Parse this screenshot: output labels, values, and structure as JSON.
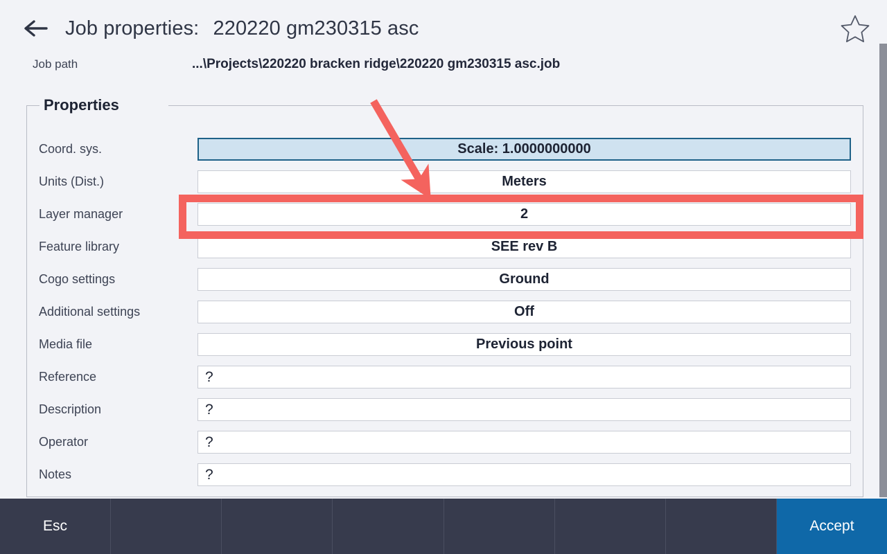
{
  "header": {
    "back_icon": "arrow-left-icon",
    "title_prefix": "Job properties:",
    "job_name": "220220 gm230315 asc",
    "favorite_icon": "star-outline-icon"
  },
  "job_path": {
    "label": "Job path",
    "value": "...\\Projects\\220220 bracken ridge\\220220 gm230315 asc.job"
  },
  "properties": {
    "legend": "Properties",
    "rows": [
      {
        "label": "Coord. sys.",
        "value": "Scale:  1.0000000000",
        "selected": true,
        "align": "center"
      },
      {
        "label": "Units (Dist.)",
        "value": "Meters",
        "selected": false,
        "align": "center"
      },
      {
        "label": "Layer manager",
        "value": "2",
        "selected": false,
        "align": "center"
      },
      {
        "label": "Feature library",
        "value": "SEE rev B",
        "selected": false,
        "align": "center"
      },
      {
        "label": "Cogo settings",
        "value": "Ground",
        "selected": false,
        "align": "center"
      },
      {
        "label": "Additional settings",
        "value": "Off",
        "selected": false,
        "align": "center"
      },
      {
        "label": "Media file",
        "value": "Previous point",
        "selected": false,
        "align": "center"
      },
      {
        "label": "Reference",
        "value": "?",
        "selected": false,
        "align": "left"
      },
      {
        "label": "Description",
        "value": "?",
        "selected": false,
        "align": "left"
      },
      {
        "label": "Operator",
        "value": "?",
        "selected": false,
        "align": "left"
      },
      {
        "label": "Notes",
        "value": "?",
        "selected": false,
        "align": "left"
      }
    ]
  },
  "toolbar": {
    "cells": [
      {
        "label": "Esc",
        "accept": false
      },
      {
        "label": "",
        "accept": false
      },
      {
        "label": "",
        "accept": false
      },
      {
        "label": "",
        "accept": false
      },
      {
        "label": "",
        "accept": false
      },
      {
        "label": "",
        "accept": false
      },
      {
        "label": "",
        "accept": false
      },
      {
        "label": "Accept",
        "accept": true
      }
    ]
  },
  "annotation": {
    "highlight_target": "Layer manager",
    "arrow_color": "#f4635e",
    "box_color": "#f4635e"
  },
  "colors": {
    "background": "#f2f3f7",
    "toolbar": "#373b4d",
    "accept": "#0f68a8",
    "selected_field": "#cfe2f0",
    "selected_border": "#1e6188",
    "annotation": "#f4635e"
  }
}
